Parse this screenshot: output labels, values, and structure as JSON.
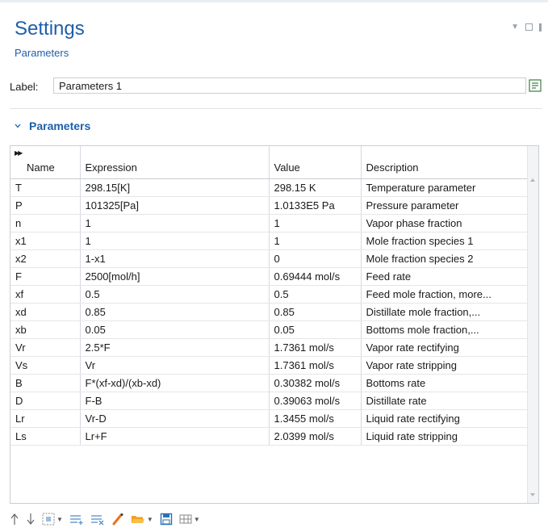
{
  "header": {
    "title": "Settings",
    "subtitle": "Parameters"
  },
  "label_field": {
    "label": "Label:",
    "value": "Parameters 1"
  },
  "section": {
    "title": "Parameters"
  },
  "table": {
    "columns": [
      "Name",
      "Expression",
      "Value",
      "Description"
    ],
    "rows": [
      [
        "T",
        "298.15[K]",
        "298.15 K",
        "Temperature parameter"
      ],
      [
        "P",
        "101325[Pa]",
        "1.0133E5 Pa",
        "Pressure parameter"
      ],
      [
        "n",
        "1",
        "1",
        "Vapor phase fraction"
      ],
      [
        "x1",
        "1",
        "1",
        "Mole fraction species 1"
      ],
      [
        "x2",
        "1-x1",
        "0",
        "Mole fraction species 2"
      ],
      [
        "F",
        "2500[mol/h]",
        "0.69444 mol/s",
        "Feed rate"
      ],
      [
        "xf",
        "0.5",
        "0.5",
        "Feed mole fraction, more..."
      ],
      [
        "xd",
        "0.85",
        "0.85",
        "Distillate mole fraction,..."
      ],
      [
        "xb",
        "0.05",
        "0.05",
        "Bottoms mole fraction,..."
      ],
      [
        "Vr",
        "2.5*F",
        "1.7361 mol/s",
        "Vapor rate rectifying"
      ],
      [
        "Vs",
        "Vr",
        "1.7361 mol/s",
        "Vapor rate stripping"
      ],
      [
        "B",
        "F*(xf-xd)/(xb-xd)",
        "0.30382 mol/s",
        "Bottoms rate"
      ],
      [
        "D",
        "F-B",
        "0.39063 mol/s",
        "Distillate rate"
      ],
      [
        "Lr",
        "Vr-D",
        "1.3455 mol/s",
        "Liquid rate rectifying"
      ],
      [
        "Ls",
        "Lr+F",
        "2.0399 mol/s",
        "Liquid rate stripping"
      ]
    ]
  },
  "toolbar_icons": [
    "move-up-icon",
    "move-down-icon",
    "select-grid-icon",
    "add-row-icon",
    "clear-rows-icon",
    "pipette-icon",
    "open-folder-icon",
    "save-icon",
    "table-options-icon"
  ],
  "colors": {
    "accent": "#1f5fa8",
    "folder": "#f0a020",
    "pipette": "#e8731a",
    "save": "#2b6fb6"
  }
}
